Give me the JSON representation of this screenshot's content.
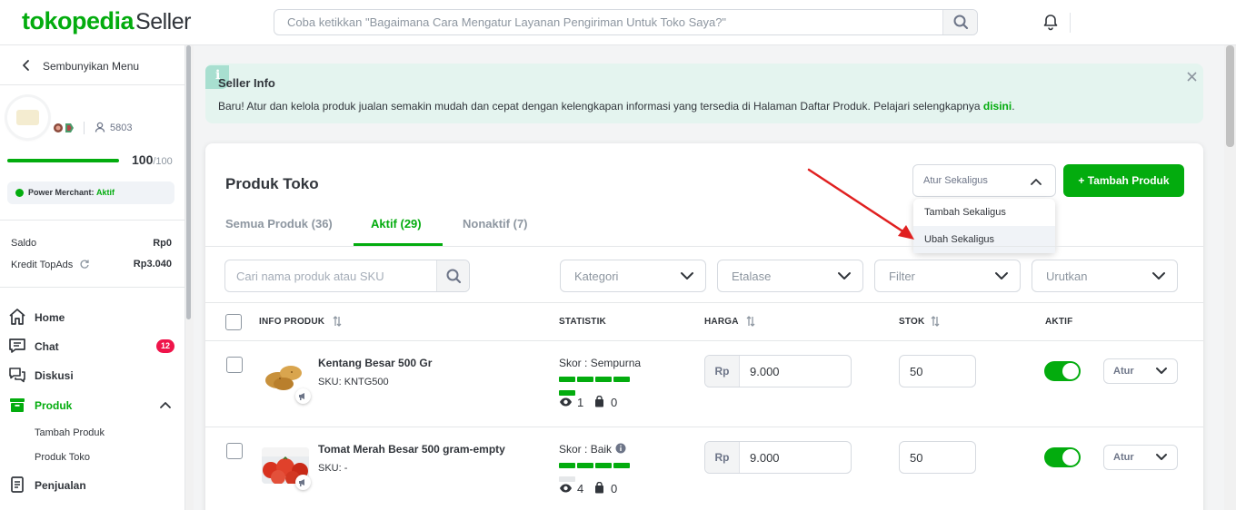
{
  "header": {
    "logo_main": "tokopedia",
    "logo_sub": "Seller",
    "search_placeholder": "Coba ketikkan \"Bagaimana Cara Mengatur Layanan Pengiriman Untuk Toko Saya?\""
  },
  "sidebar": {
    "hide_menu": "Sembunyikan Menu",
    "followers": "5803",
    "score": "100",
    "score_max": "/100",
    "score_fraction": 1.0,
    "power_merchant_label": "Power Merchant: ",
    "power_merchant_status": "Aktif",
    "saldo_label": "Saldo",
    "saldo_value": "Rp0",
    "kredit_label": "Kredit TopAds",
    "kredit_value": "Rp3.040",
    "nav": {
      "home": "Home",
      "chat": "Chat",
      "chat_badge": "12",
      "diskusi": "Diskusi",
      "produk": "Produk",
      "tambah_produk": "Tambah Produk",
      "produk_toko": "Produk Toko",
      "penjualan": "Penjualan"
    }
  },
  "info": {
    "icon": "i",
    "title": "Seller Info",
    "text": "Baru! Atur dan kelola produk jualan semakin mudah dan cepat dengan kelengkapan informasi yang tersedia di Halaman Daftar Produk. Pelajari selengkapnya ",
    "link": "disini",
    "text_end": "."
  },
  "products_page": {
    "title": "Produk Toko",
    "bulk_select": "Atur Sekaligus",
    "add_button": "+ Tambah Produk",
    "dropdown": [
      "Tambah Sekaligus",
      "Ubah Sekaligus"
    ],
    "tabs": [
      "Semua Produk (36)",
      "Aktif (29)",
      "Nonaktif (7)"
    ],
    "active_tab": "Aktif (29)",
    "search_placeholder": "Cari nama produk atau SKU",
    "filters": [
      "Kategori",
      "Etalase",
      "Filter",
      "Urutkan"
    ],
    "columns": [
      "INFO PRODUK",
      "STATISTIK",
      "HARGA",
      "STOK",
      "AKTIF"
    ],
    "currency": "Rp",
    "action_label": "Atur",
    "rows": [
      {
        "name": "Kentang Besar 500 Gr",
        "sku": "SKU: KNTG500",
        "skor_label": "Skor : ",
        "skor_value": "Sempurna",
        "skor_level": 5,
        "views": "1",
        "sold": "0",
        "price": "9.000",
        "stock": "50",
        "active": true
      },
      {
        "name": "Tomat Merah Besar 500 gram-empty",
        "sku": "SKU: -",
        "skor_label": "Skor : ",
        "skor_value": "Baik",
        "skor_level": 4,
        "views": "4",
        "sold": "0",
        "price": "9.000",
        "stock": "50",
        "active": true
      }
    ]
  },
  "colors": {
    "brand": "#03ac0e",
    "badge": "#ef144a",
    "info_bg": "#e4f4ef",
    "annotation_arrow": "#e02020"
  }
}
